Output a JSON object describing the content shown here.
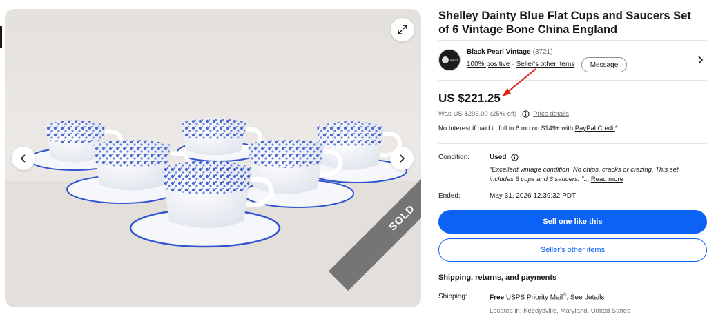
{
  "listing": {
    "title": "Shelley Dainty Blue Flat Cups and Saucers Set of 6 Vintage Bone China England",
    "sold_badge": "SOLD"
  },
  "seller": {
    "name": "Black Pearl Vintage",
    "feedback_count": "(3721)",
    "positive": "100% positive",
    "separator": "·",
    "other_items": "Seller's other items",
    "message_label": "Message",
    "avatar_text": "Black Pearl"
  },
  "pricing": {
    "price": "US $221.25",
    "was_label": "Was",
    "was_price": "US $295.00",
    "discount": "(25% off)",
    "details_label": "Price details",
    "credit_prefix": "No Interest if paid in full in 6 mo on $149+ with",
    "credit_link": "PayPal Credit",
    "credit_suffix": "*"
  },
  "condition": {
    "label": "Condition:",
    "value": "Used",
    "quote": "“Excellent vintage condition. No chips, cracks or crazing. This set includes 6 cups and 6 saucers. ”",
    "ellipsis": "...",
    "read_more": "Read more"
  },
  "ended": {
    "label": "Ended:",
    "value": "May 31, 2026 12:39:32 PDT"
  },
  "actions": {
    "sell_label": "Sell one like this",
    "other_items_label": "Seller's other items"
  },
  "shipping": {
    "heading": "Shipping, returns, and payments",
    "label": "Shipping:",
    "free": "Free",
    "service": "USPS Priority Mail",
    "service_mark": "®",
    "period": ".",
    "see_details": "See details",
    "location": "Located in: Keedysville, Maryland, United States"
  },
  "theme": {
    "accent": "#0b62f5",
    "annotation_arrow": "#e0201b",
    "sold_band": "#757575"
  },
  "icons": [
    "expand-icon",
    "chevron-left-icon",
    "chevron-right-icon",
    "info-icon",
    "arrow-annotation"
  ]
}
